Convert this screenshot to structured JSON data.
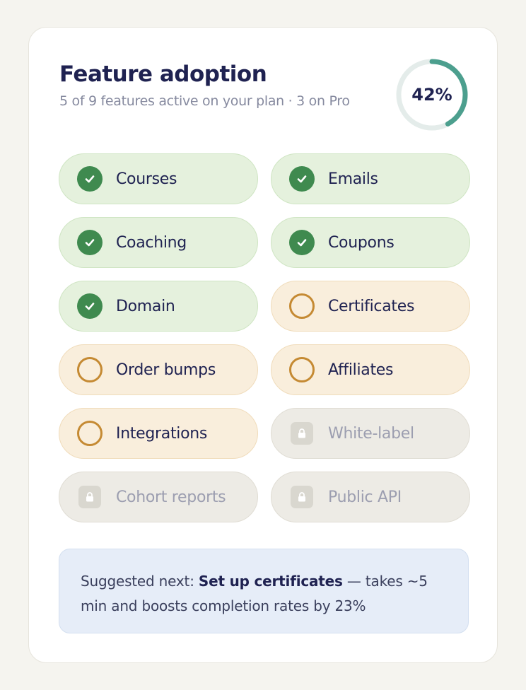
{
  "card": {
    "title": "Feature adoption",
    "subtitle": "5 of 9 features active on your plan · 3 on Pro"
  },
  "progress": {
    "label": "42%",
    "fraction": 0.42,
    "color": "#4c9f8e",
    "track_color": "#e4ecea"
  },
  "features": [
    {
      "label": "Courses",
      "status": "active",
      "icon": "check-icon"
    },
    {
      "label": "Emails",
      "status": "active",
      "icon": "check-icon"
    },
    {
      "label": "Coaching",
      "status": "active",
      "icon": "check-icon"
    },
    {
      "label": "Coupons",
      "status": "active",
      "icon": "check-icon"
    },
    {
      "label": "Domain",
      "status": "active",
      "icon": "check-icon"
    },
    {
      "label": "Certificates",
      "status": "pending",
      "icon": "empty-circle-icon"
    },
    {
      "label": "Order bumps",
      "status": "pending",
      "icon": "empty-circle-icon"
    },
    {
      "label": "Affiliates",
      "status": "pending",
      "icon": "empty-circle-icon"
    },
    {
      "label": "Integrations",
      "status": "pending",
      "icon": "empty-circle-icon"
    },
    {
      "label": "White-label",
      "status": "locked",
      "icon": "lock-icon"
    },
    {
      "label": "Cohort reports",
      "status": "locked",
      "icon": "lock-icon"
    },
    {
      "label": "Public API",
      "status": "locked",
      "icon": "lock-icon"
    }
  ],
  "suggestion": {
    "prefix": "Suggested next: ",
    "action": "Set up certificates",
    "suffix": " — takes ~5 min and boosts completion rates by 23%"
  },
  "colors": {
    "active_bg": "#e5f1dd",
    "pending_bg": "#f9eedc",
    "locked_bg": "#edebe5",
    "check_green": "#3f8a4f",
    "pending_orange": "#c58a33"
  }
}
